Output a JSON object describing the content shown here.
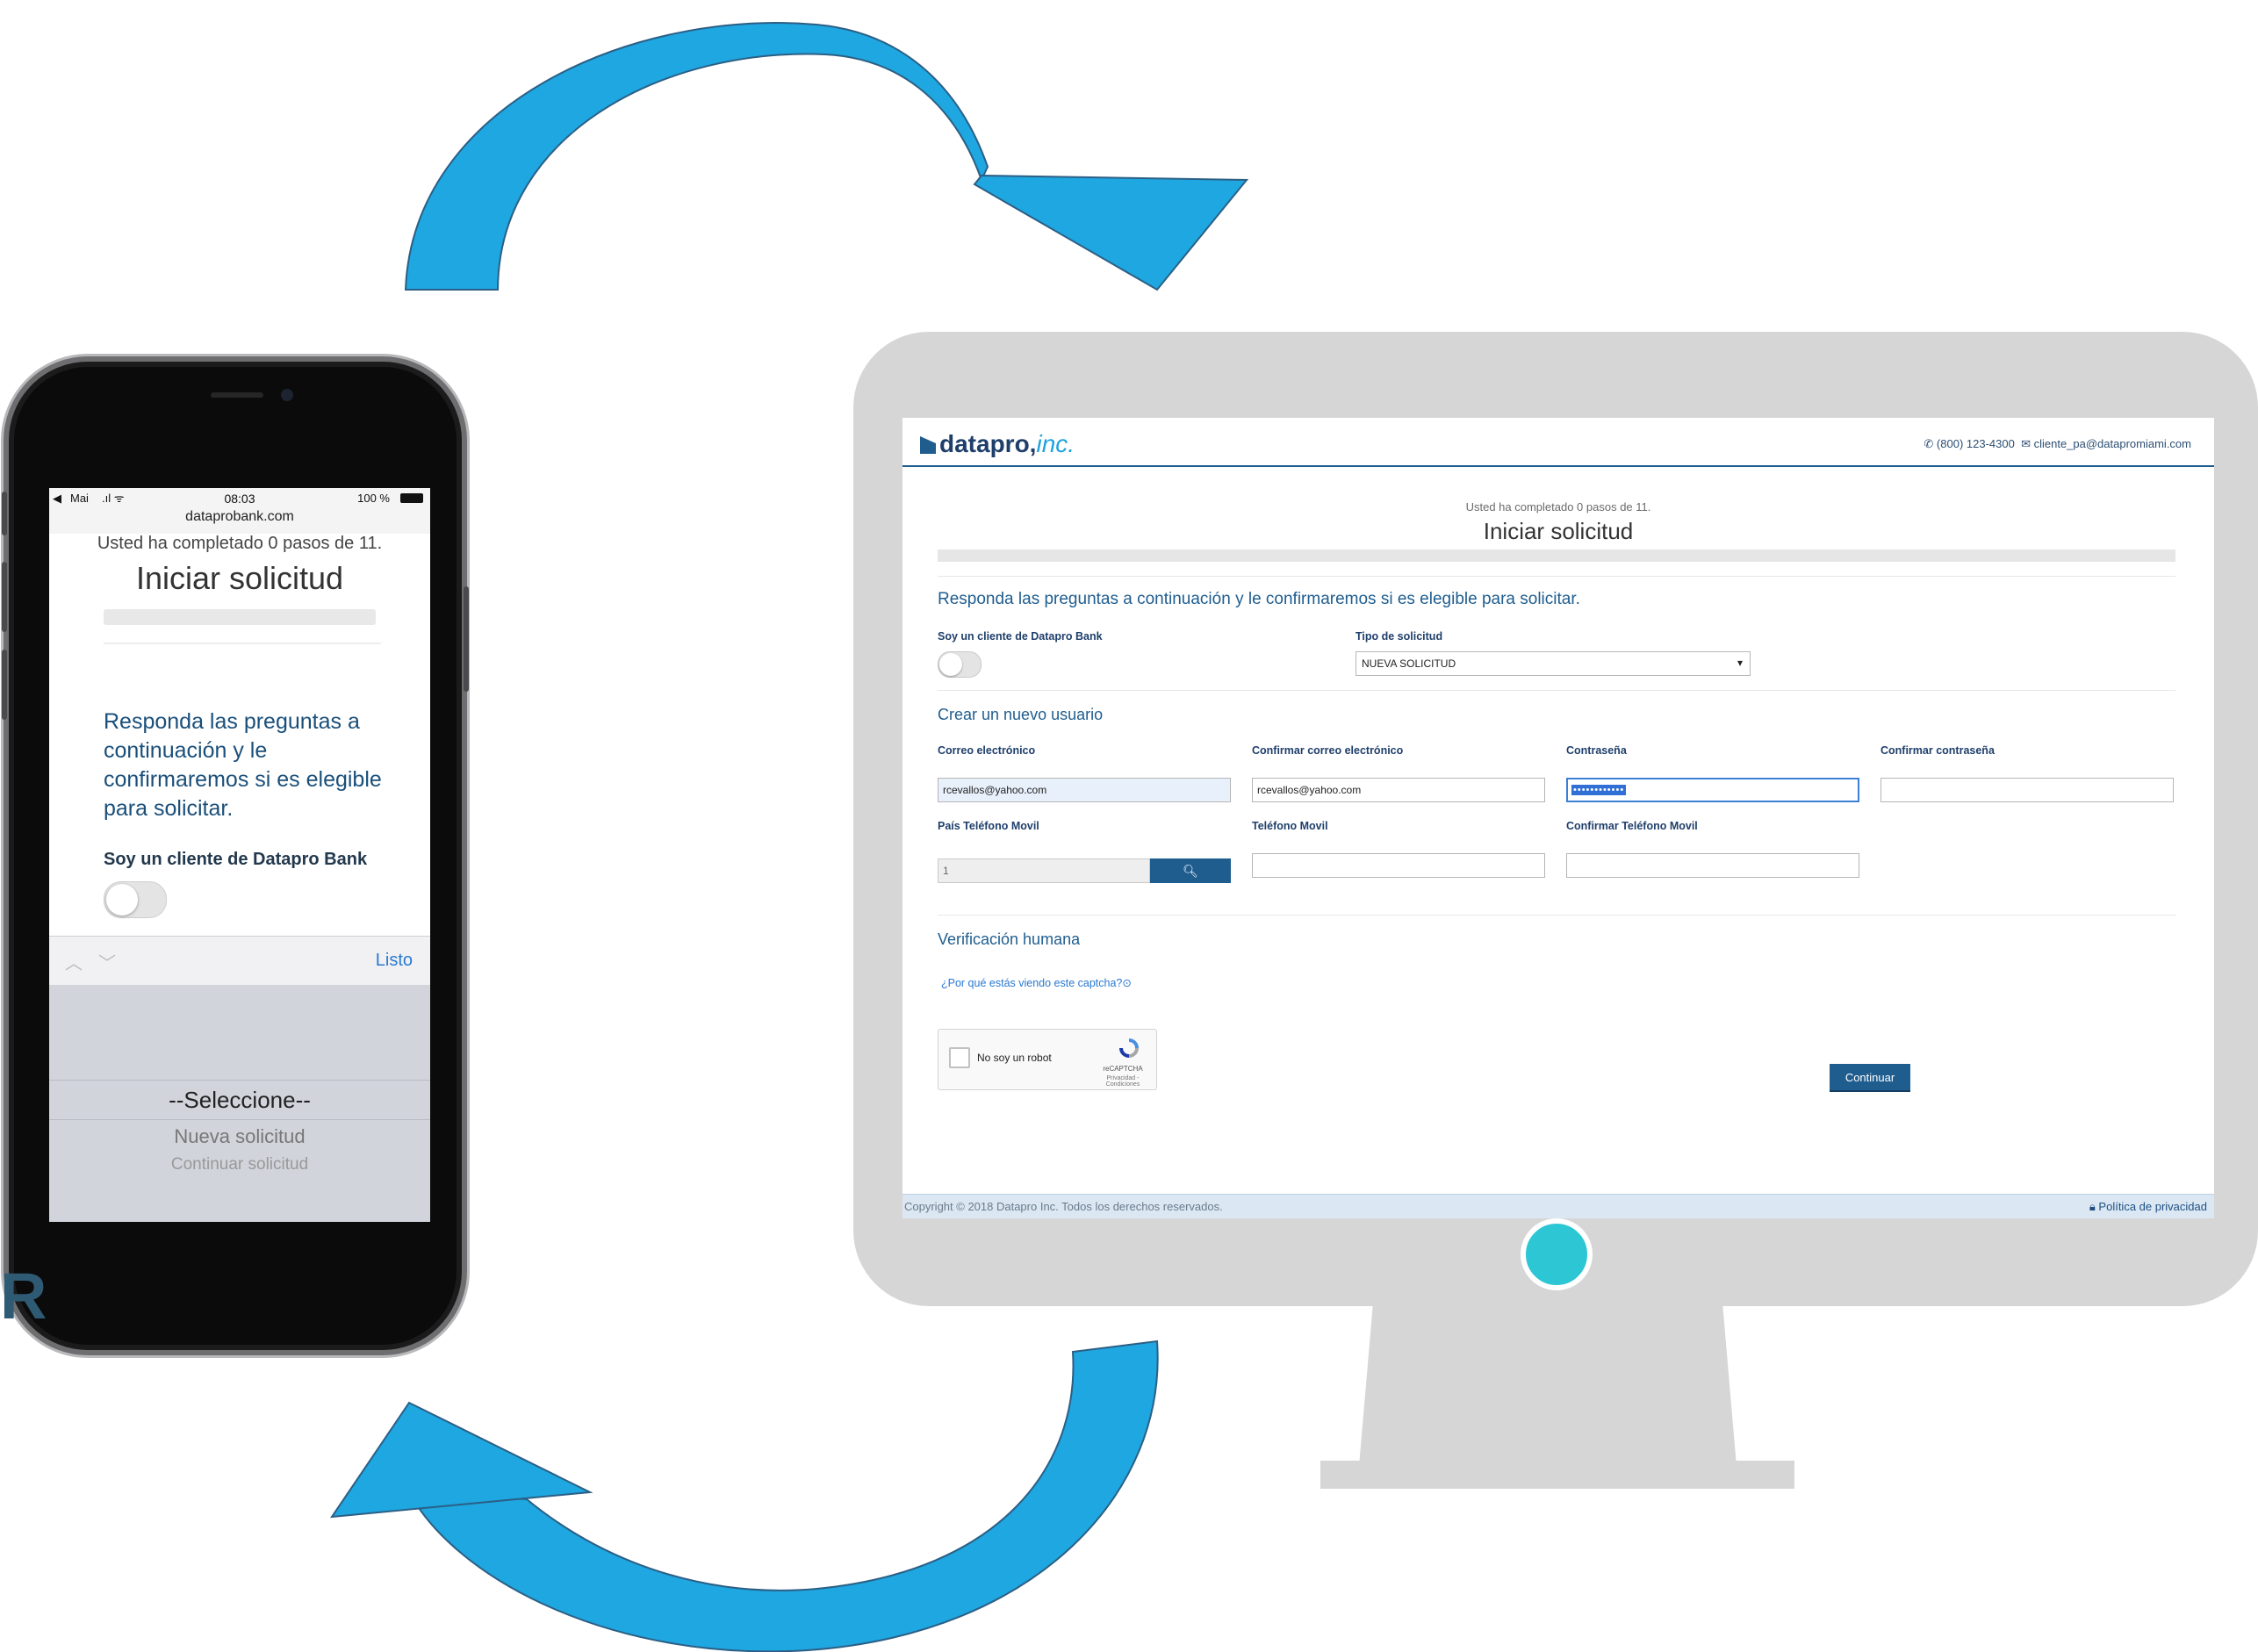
{
  "colors": {
    "arrow": "#1ea7e1",
    "monitor": "#d6d6d6",
    "accent": "#1f5d8f",
    "monitor_button": "#2cc6d4"
  },
  "mobile": {
    "status": {
      "carrier": "Mai",
      "time": "08:03",
      "battery": "100 %"
    },
    "url": "dataprobank.com",
    "steps_text": "Usted ha completado 0 pasos de 11.",
    "title": "Iniciar solicitud",
    "question": "Responda las preguntas a continuación y le confirmaremos si es elegible para solicitar.",
    "cliente_label": "Soy un cliente de Datapro Bank",
    "toolbar_done": "Listo",
    "picker_options": [
      "--Seleccione--",
      "Nueva solicitud",
      "Continuar solicitud"
    ]
  },
  "stray_letter": "R",
  "desktop": {
    "logo": {
      "name": "datapro,",
      "suffix": "inc."
    },
    "contact": {
      "phone": "(800) 123-4300",
      "email": "cliente_pa@datapromiami.com"
    },
    "steps_text": "Usted ha completado 0 pasos de 11.",
    "title": "Iniciar solicitud",
    "question": "Responda las preguntas a continuación y le confirmaremos si es elegible para solicitar.",
    "cliente_label": "Soy un cliente de Datapro Bank",
    "tipo_label": "Tipo de solicitud",
    "tipo_value": "NUEVA SOLICITUD",
    "section_user": "Crear un nuevo usuario",
    "labels": {
      "email": "Correo electrónico",
      "email_confirm": "Confirmar correo electrónico",
      "password": "Contraseña",
      "password_confirm": "Confirmar contraseña",
      "pais_tel": "País Teléfono Movil",
      "tel": "Teléfono Movil",
      "tel_confirm": "Confirmar Teléfono Movil"
    },
    "values": {
      "email": "rcevallos@yahoo.com",
      "email_confirm": "rcevallos@yahoo.com",
      "password": "••••••••••••",
      "password_confirm": "",
      "pais_tel": "1",
      "tel": "",
      "tel_confirm": ""
    },
    "section_verif": "Verificación humana",
    "why_captcha": "¿Por qué estás viendo este captcha?",
    "captcha": {
      "text": "No soy un robot",
      "brand": "reCAPTCHA",
      "terms": "Privacidad - Condiciones"
    },
    "continue_button": "Continuar",
    "footer": {
      "copyright": "Copyright © 2018 Datapro Inc. Todos los derechos reservados.",
      "privacy": "Política de privacidad"
    }
  }
}
